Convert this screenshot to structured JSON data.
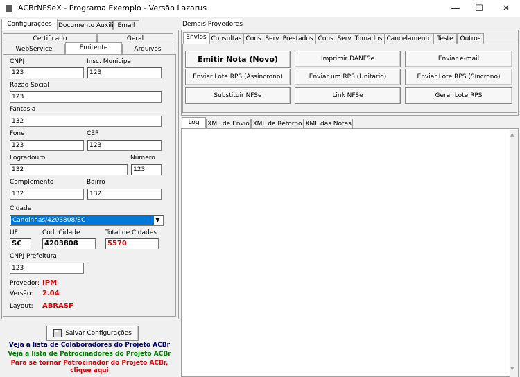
{
  "window": {
    "title": "ACBrNFSeX - Programa Exemplo - Versão Lazarus",
    "minimize_glyph": "—",
    "maximize_glyph": "☐",
    "close_glyph": "✕"
  },
  "left": {
    "top_tabs": [
      "Configurações",
      "Documento Auxiliar",
      "Email"
    ],
    "sub_tabs_row1": [
      "Certificado",
      "Geral"
    ],
    "sub_tabs_row2": [
      "WebService",
      "Emitente",
      "Arquivos"
    ],
    "fields": {
      "cnpj": {
        "label": "CNPJ",
        "value": "123"
      },
      "insc_municipal": {
        "label": "Insc. Municipal",
        "value": "123"
      },
      "razao_social": {
        "label": "Razão Social",
        "value": "123"
      },
      "fantasia": {
        "label": "Fantasia",
        "value": "132"
      },
      "fone": {
        "label": "Fone",
        "value": "123"
      },
      "cep": {
        "label": "CEP",
        "value": "123"
      },
      "logradouro": {
        "label": "Logradouro",
        "value": "132"
      },
      "numero": {
        "label": "Número",
        "value": "123"
      },
      "complemento": {
        "label": "Complemento",
        "value": "132"
      },
      "bairro": {
        "label": "Bairro",
        "value": "132"
      },
      "cidade": {
        "label": "Cidade",
        "value": "Canoinhas/4203808/SC"
      },
      "uf": {
        "label": "UF",
        "value": "SC"
      },
      "cod_cidade": {
        "label": "Cód. Cidade",
        "value": "4203808"
      },
      "total_cidades": {
        "label": "Total de Cidades",
        "value": "5570"
      },
      "cnpj_prefeitura": {
        "label": "CNPJ Prefeitura",
        "value": "123"
      }
    },
    "info": {
      "provedor_label": "Provedor:",
      "provedor_value": "IPM",
      "versao_label": "Versão:",
      "versao_value": "2.04",
      "layout_label": "Layout:",
      "layout_value": "ABRASF"
    },
    "save_button": "Salvar Configurações",
    "links": {
      "colaboradores": "Veja a lista de Colaboradores do Projeto ACBr",
      "patrocinadores": "Veja a lista de Patrocinadores do Projeto ACBr",
      "patrocinar_line1": "Para se tornar Patrocinador do Projeto ACBr,",
      "patrocinar_line2": "clique aqui"
    }
  },
  "right": {
    "top_tab": "Demais Provedores",
    "tabs": [
      "Envios",
      "Consultas",
      "Cons. Serv. Prestados",
      "Cons. Serv. Tomados",
      "Cancelamento",
      "Teste",
      "Outros"
    ],
    "buttons": {
      "emitir_nota": "Emitir Nota (Novo)",
      "imprimir_danfse": "Imprimir DANFSe",
      "enviar_email": "Enviar e-mail",
      "enviar_lote_assinc": "Enviar Lote RPS (Assíncrono)",
      "enviar_um_rps": "Enviar um RPS (Unitário)",
      "enviar_lote_sinc": "Enviar Lote RPS (Síncrono)",
      "substituir_nfse": "Substituir NFSe",
      "link_nfse": "Link NFSe",
      "gerar_lote": "Gerar Lote RPS"
    },
    "log_tabs": [
      "Log",
      "XML de Envio",
      "XML de Retorno",
      "XML das Notas"
    ]
  },
  "colors": {
    "link_blue": "#000080",
    "link_green": "#008000",
    "link_red": "#e00000",
    "value_red": "#e00000",
    "selection_blue": "#0078d7"
  }
}
